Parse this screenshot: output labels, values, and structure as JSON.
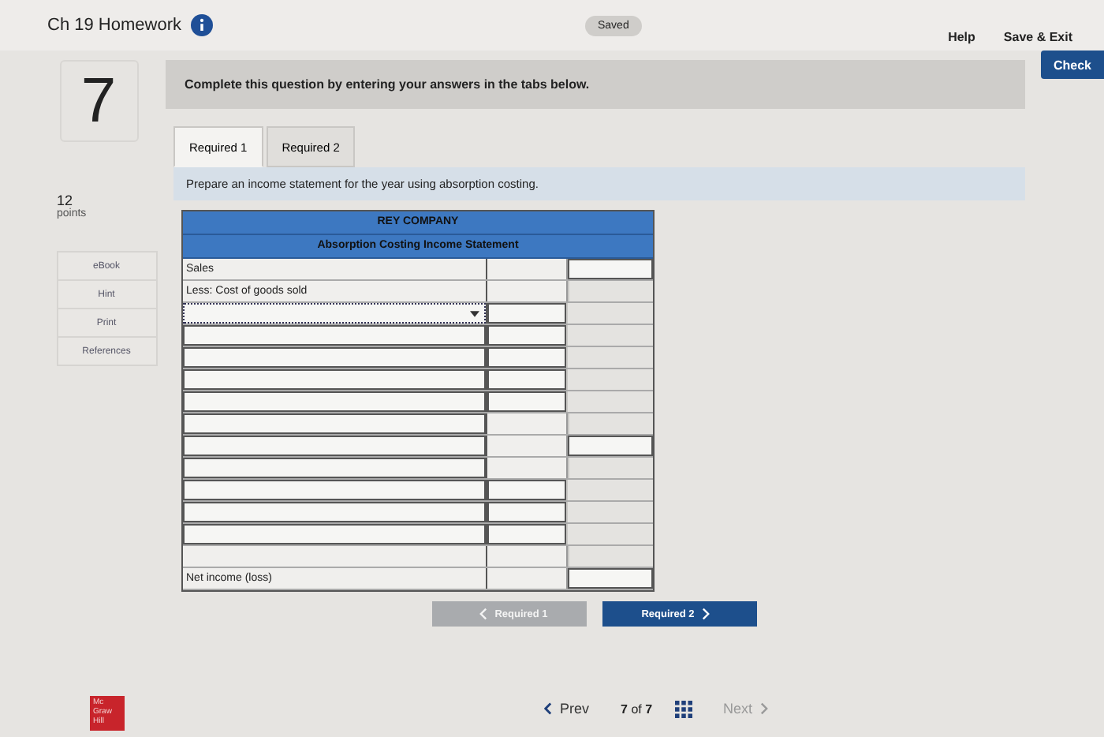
{
  "header": {
    "title": "Ch 19 Homework",
    "status": "Saved",
    "links": [
      "Help",
      "Save & Exit"
    ]
  },
  "check_button": "Check",
  "question": {
    "number": "7",
    "points": "12",
    "points_label": "points",
    "instruction": "Complete this question by entering your answers in the tabs below."
  },
  "side_buttons": [
    "eBook",
    "Hint",
    "Print",
    "References"
  ],
  "tabs": [
    {
      "label": "Required 1",
      "selected": true
    },
    {
      "label": "Required 2",
      "selected": false
    }
  ],
  "prompt": "Prepare an income statement for the year using absorption costing.",
  "statement": {
    "company": "REY COMPANY",
    "title": "Absorption Costing Income Statement",
    "rows": [
      {
        "kind": "text",
        "label": "Sales",
        "amount_field": false,
        "total_field": true
      },
      {
        "kind": "text",
        "label": "Less: Cost of goods sold",
        "amount_field": false,
        "total_field": false
      },
      {
        "kind": "select",
        "amount_field": true,
        "total_field": false
      },
      {
        "kind": "input",
        "amount_field": true,
        "total_field": false
      },
      {
        "kind": "input",
        "amount_field": true,
        "total_field": false
      },
      {
        "kind": "input",
        "amount_field": true,
        "total_field": false
      },
      {
        "kind": "input",
        "amount_field": true,
        "total_field": false
      },
      {
        "kind": "input",
        "amount_field": false,
        "total_field": false
      },
      {
        "kind": "input",
        "amount_field": false,
        "total_field": true
      },
      {
        "kind": "input",
        "amount_field": false,
        "total_field": false
      },
      {
        "kind": "input",
        "amount_field": true,
        "total_field": false
      },
      {
        "kind": "input",
        "amount_field": true,
        "total_field": false
      },
      {
        "kind": "input",
        "amount_field": true,
        "total_field": false
      },
      {
        "kind": "blank",
        "amount_field": false,
        "total_field": false
      },
      {
        "kind": "text",
        "label": "Net income (loss)",
        "amount_field": false,
        "total_field": true
      }
    ]
  },
  "tab_nav": [
    {
      "label": "Required 1",
      "disabled": true
    },
    {
      "label": "Required 2",
      "disabled": false
    }
  ],
  "pager": {
    "prev": "Prev",
    "current": "7",
    "of": "of",
    "total": "7",
    "next": "Next",
    "next_disabled": true
  },
  "logo": [
    "Mc",
    "Graw",
    "Hill"
  ]
}
